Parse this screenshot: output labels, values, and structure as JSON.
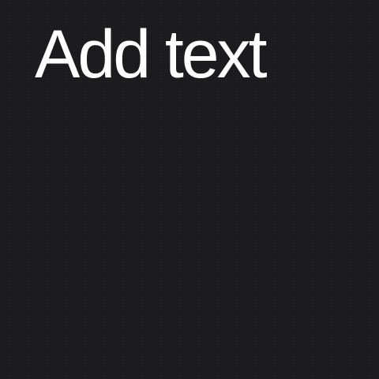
{
  "canvas": {
    "background_color": "#1c1c1e",
    "text_box": {
      "text": "Add text",
      "color": "#ffffff"
    }
  }
}
